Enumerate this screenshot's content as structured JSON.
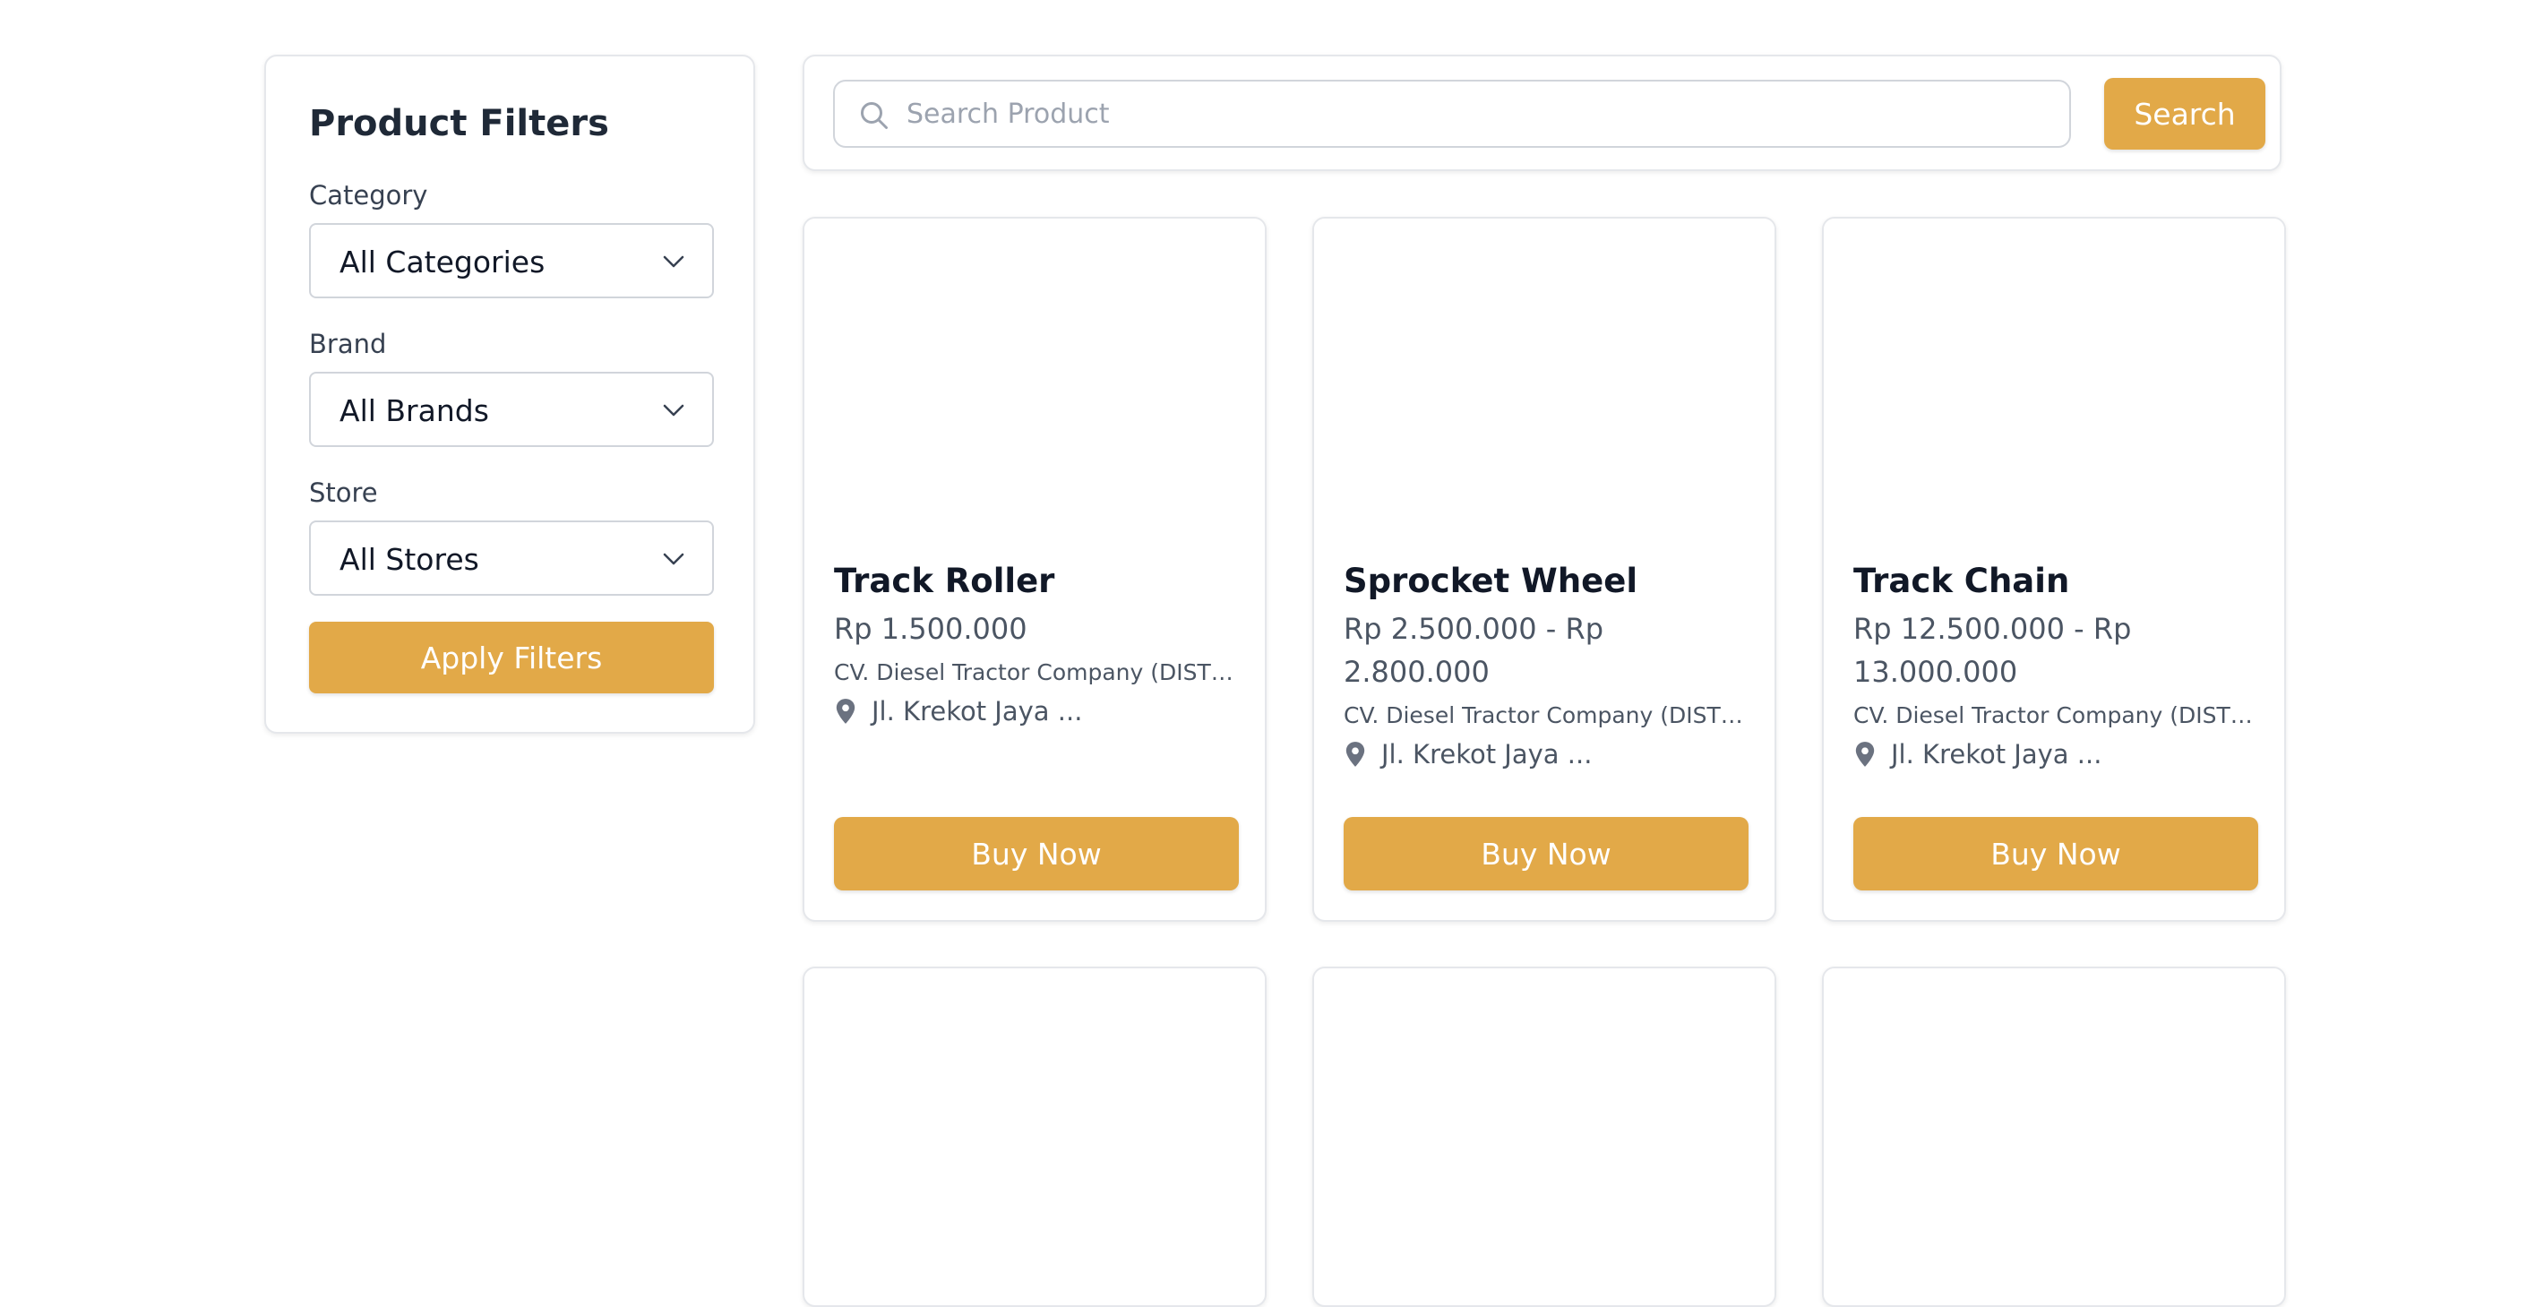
{
  "filters": {
    "title": "Product Filters",
    "category": {
      "label": "Category",
      "value": "All Categories"
    },
    "brand": {
      "label": "Brand",
      "value": "All Brands"
    },
    "store": {
      "label": "Store",
      "value": "All Stores"
    },
    "apply_label": "Apply Filters"
  },
  "search": {
    "placeholder": "Search Product",
    "value": "",
    "button_label": "Search"
  },
  "colors": {
    "accent": "#E2A948",
    "border": "#E5E7EB",
    "text_primary": "#111827",
    "text_secondary": "#4B5563"
  },
  "icons": {
    "search": "search-icon",
    "chevron": "chevron-down-icon",
    "pin": "map-pin-icon"
  },
  "products": [
    {
      "name": "Track Roller",
      "price": "Rp 1.500.000",
      "store": "CV. Diesel Tractor Company (DISTR...",
      "location": "Jl. Krekot Jaya ...",
      "button_label": "Buy Now"
    },
    {
      "name": "Sprocket Wheel",
      "price": "Rp 2.500.000 - Rp 2.800.000",
      "store": "CV. Diesel Tractor Company (DISTR...",
      "location": "Jl. Krekot Jaya ...",
      "button_label": "Buy Now"
    },
    {
      "name": "Track Chain",
      "price": "Rp 12.500.000 - Rp 13.000.000",
      "store": "CV. Diesel Tractor Company (DISTR...",
      "location": "Jl. Krekot Jaya ...",
      "button_label": "Buy Now"
    }
  ]
}
